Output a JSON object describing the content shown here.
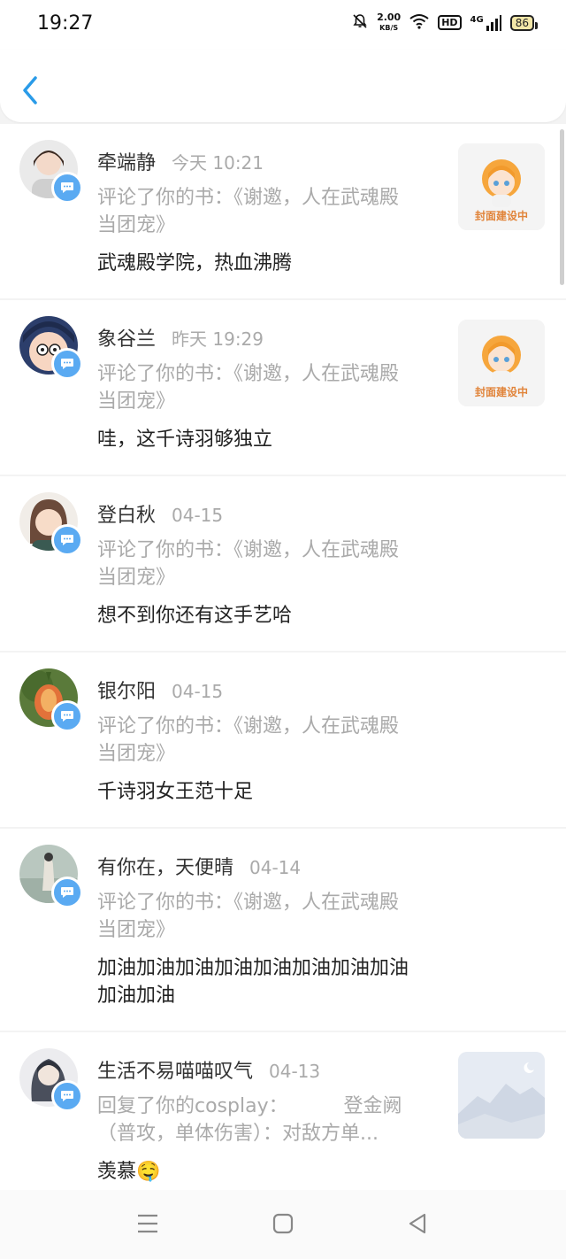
{
  "status_bar": {
    "time": "19:27",
    "net_speed_value": "2.00",
    "net_speed_unit": "KB/S",
    "hd": "HD",
    "network": "4G",
    "battery": "86"
  },
  "messages": [
    {
      "name": "牵端静",
      "time": "今天 10:21",
      "desc": "评论了你的书：《谢邀，人在武魂殿当团宠》",
      "comment": "武魂殿学院，热血沸腾",
      "thumb_label": "封面建设中",
      "avatar_color": "#d9d9d9"
    },
    {
      "name": "象谷兰",
      "time": "昨天 19:29",
      "desc": "评论了你的书：《谢邀，人在武魂殿当团宠》",
      "comment": "哇，这千诗羽够独立",
      "thumb_label": "封面建设中",
      "avatar_color": "#2c3e6b"
    },
    {
      "name": "登白秋",
      "time": "04-15",
      "desc": "评论了你的书：《谢邀，人在武魂殿当团宠》",
      "comment": "想不到你还有这手艺哈",
      "avatar_color": "#6b4a3a"
    },
    {
      "name": "银尔阳",
      "time": "04-15",
      "desc": "评论了你的书：《谢邀，人在武魂殿当团宠》",
      "comment": "千诗羽女王范十足",
      "avatar_color": "#5a7a3a"
    },
    {
      "name": "有你在，天便晴",
      "time": "04-14",
      "desc": "评论了你的书：《谢邀，人在武魂殿当团宠》",
      "comment": "加油加油加油加油加油加油加油加油加油加油",
      "avatar_color": "#b9c7bf"
    },
    {
      "name": "生活不易喵喵叹气",
      "time": "04-13",
      "desc": "回复了你的cosplay：         登金阙（普攻，单体伤害）：对敌方单...",
      "comment": "羡慕🤤",
      "avatar_color": "#8a8f9c"
    }
  ]
}
